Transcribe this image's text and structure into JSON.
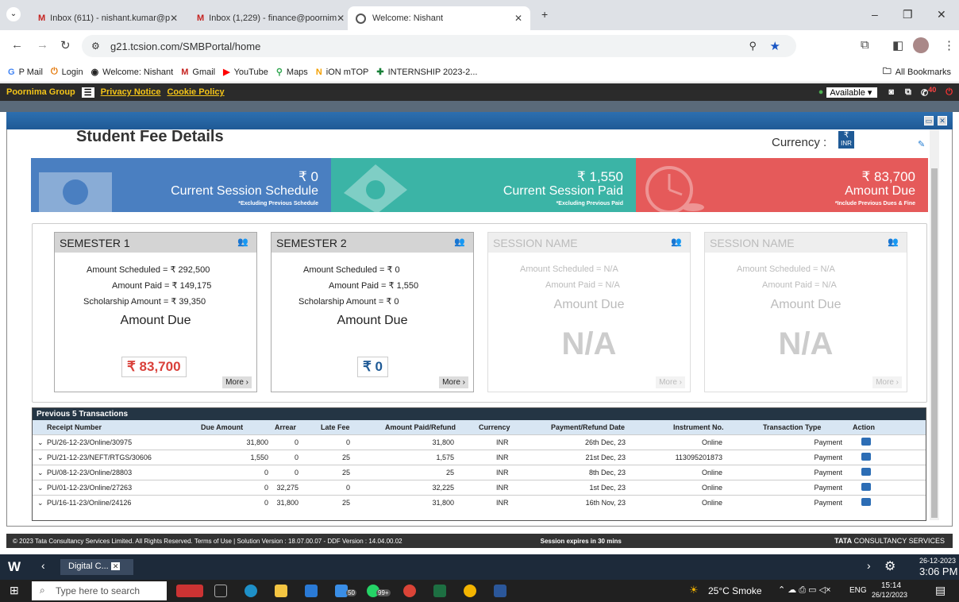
{
  "browser": {
    "tabs": [
      {
        "title": "Inbox (611) - nishant.kumar@p"
      },
      {
        "title": "Inbox (1,229) - finance@poornim"
      },
      {
        "title": "Welcome: Nishant"
      }
    ],
    "url": "g21.tcsion.com/SMBPortal/home",
    "bookmarks": [
      "P Mail",
      "Login",
      "Welcome: Nishant",
      "Gmail",
      "YouTube",
      "Maps",
      "iON mTOP",
      "INTERNSHIP 2023-2..."
    ],
    "all_bookmarks": "All Bookmarks"
  },
  "portal": {
    "org": "Poornima Group",
    "privacy": "Privacy Notice",
    "cookie": "Cookie Policy",
    "status": "Available",
    "notif_count": "40"
  },
  "page": {
    "title": "Student Fee Details",
    "currency_label": "Currency :",
    "currency_icon_text": "INR"
  },
  "summary": [
    {
      "amount": "₹ 0",
      "label": "Current Session Schedule",
      "note": "*Excluding Previous Schedule",
      "color": "#4a7fc1"
    },
    {
      "amount": "₹ 1,550",
      "label": "Current Session Paid",
      "note": "*Excluding Previous Paid",
      "color": "#3bb4a6"
    },
    {
      "amount": "₹ 83,700",
      "label": "Amount Due",
      "note": "*Include Previous Dues & Fine",
      "color": "#e55a5a"
    }
  ],
  "semesters": [
    {
      "name": "SEMESTER 1",
      "scheduled": "Amount Scheduled = ₹ 292,500",
      "paid": "Amount Paid = ₹ 149,175",
      "scholarship": "Scholarship Amount = ₹ 39,350",
      "due_label": "Amount Due",
      "due": "₹ 83,700",
      "more": "More"
    },
    {
      "name": "SEMESTER 2",
      "scheduled": "Amount Scheduled = ₹ 0",
      "paid": "Amount Paid = ₹ 1,550",
      "scholarship": "Scholarship Amount = ₹ 0",
      "due_label": "Amount Due",
      "due": "₹ 0",
      "more": "More"
    },
    {
      "name": "SESSION NAME",
      "scheduled": "Amount Scheduled = N/A",
      "paid": "Amount Paid = N/A",
      "due_label": "Amount Due",
      "due": "N/A",
      "more": "More"
    },
    {
      "name": "SESSION NAME",
      "scheduled": "Amount Scheduled = N/A",
      "paid": "Amount Paid = N/A",
      "due_label": "Amount Due",
      "due": "N/A",
      "more": "More"
    }
  ],
  "transactions": {
    "title": "Previous 5 Transactions",
    "headers": [
      "Receipt Number",
      "Due Amount",
      "Arrear",
      "Late Fee",
      "Amount Paid/Refund",
      "Currency",
      "Payment/Refund Date",
      "Instrument No.",
      "Transaction Type",
      "Action"
    ],
    "rows": [
      [
        "PU/26-12-23/Online/30975",
        "31,800",
        "0",
        "0",
        "31,800",
        "INR",
        "26th Dec, 23",
        "Online",
        "Payment"
      ],
      [
        "PU/21-12-23/NEFT/RTGS/30606",
        "1,550",
        "0",
        "25",
        "1,575",
        "INR",
        "21st Dec, 23",
        "113095201873",
        "Payment"
      ],
      [
        "PU/08-12-23/Online/28803",
        "0",
        "0",
        "25",
        "25",
        "INR",
        "8th Dec, 23",
        "Online",
        "Payment"
      ],
      [
        "PU/01-12-23/Online/27263",
        "0",
        "32,275",
        "0",
        "32,225",
        "INR",
        "1st Dec, 23",
        "Online",
        "Payment"
      ],
      [
        "PU/16-11-23/Online/24126",
        "0",
        "31,800",
        "25",
        "31,800",
        "INR",
        "16th Nov, 23",
        "Online",
        "Payment"
      ]
    ]
  },
  "footer": {
    "copyright": "© 2023 Tata Consultancy Services Limited. All Rights Reserved.   Terms of Use | Solution Version : 18.07.00.07 - DDF Version : 14.04.00.02",
    "session": "Session expires in 30 mins",
    "brand_bold": "TATA",
    "brand_rest": "CONSULTANCY SERVICES"
  },
  "strip": {
    "chip": "Digital C...",
    "date": "26-12-2023",
    "time": "3:06 PM"
  },
  "taskbar": {
    "search": "Type here to search",
    "weather": "25°C Smoke",
    "lang": "ENG",
    "time": "15:14",
    "date": "26/12/2023",
    "badge1": "50",
    "badge2": "99+"
  }
}
